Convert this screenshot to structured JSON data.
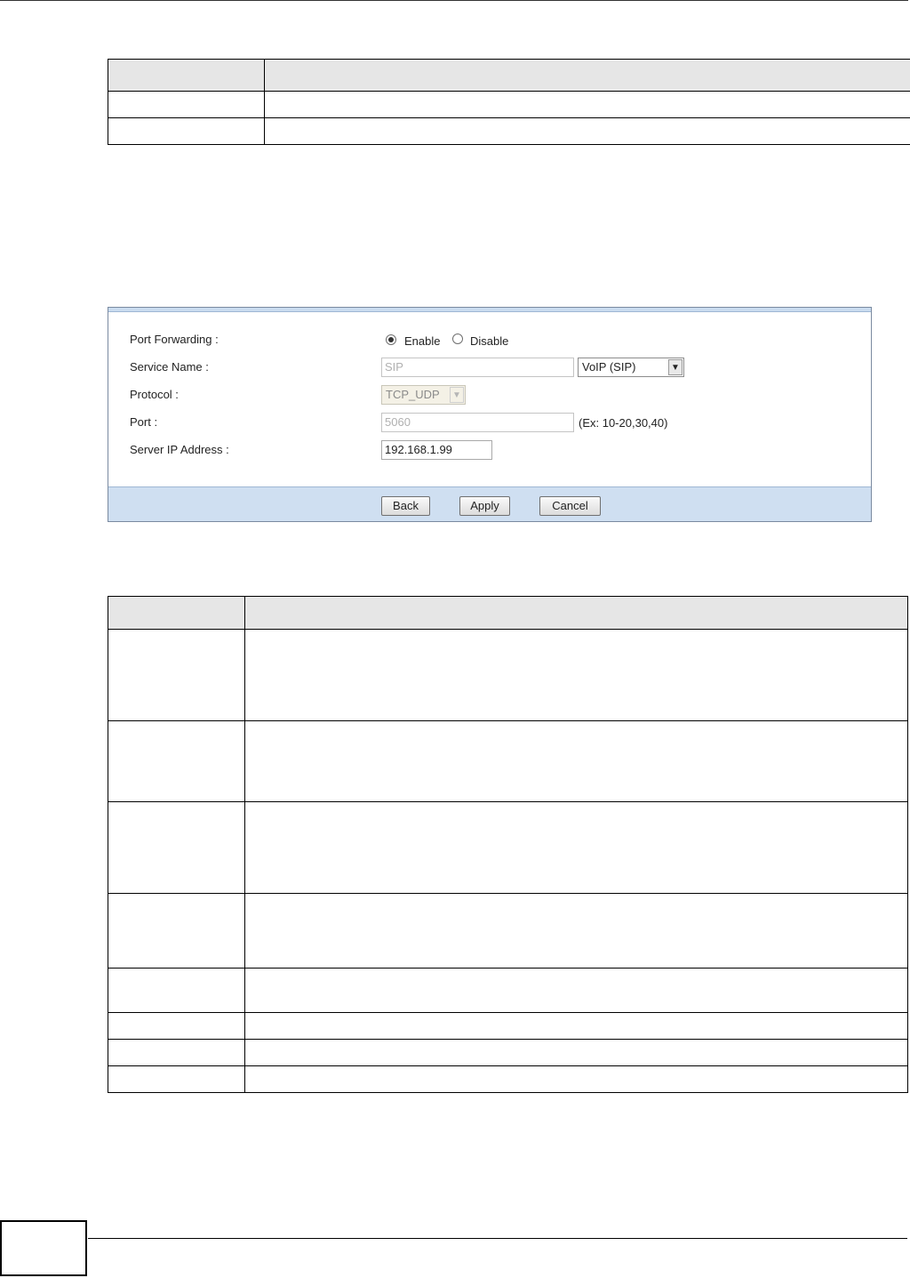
{
  "form": {
    "port_forwarding_label": "Port Forwarding :",
    "enable_label": "Enable",
    "disable_label": "Disable",
    "service_name_label": "Service Name :",
    "service_name_value": "SIP",
    "service_select_value": "VoIP (SIP)",
    "protocol_label": "Protocol :",
    "protocol_value": "TCP_UDP",
    "port_label": "Port :",
    "port_value": "5060",
    "port_hint": "(Ex: 10-20,30,40)",
    "server_ip_label": "Server IP Address :",
    "server_ip_value": "192.168.1.99",
    "port_forwarding_enabled": true
  },
  "buttons": {
    "back": "Back",
    "apply": "Apply",
    "cancel": "Cancel"
  },
  "icons": {
    "dropdown": "chevron-down-icon"
  }
}
